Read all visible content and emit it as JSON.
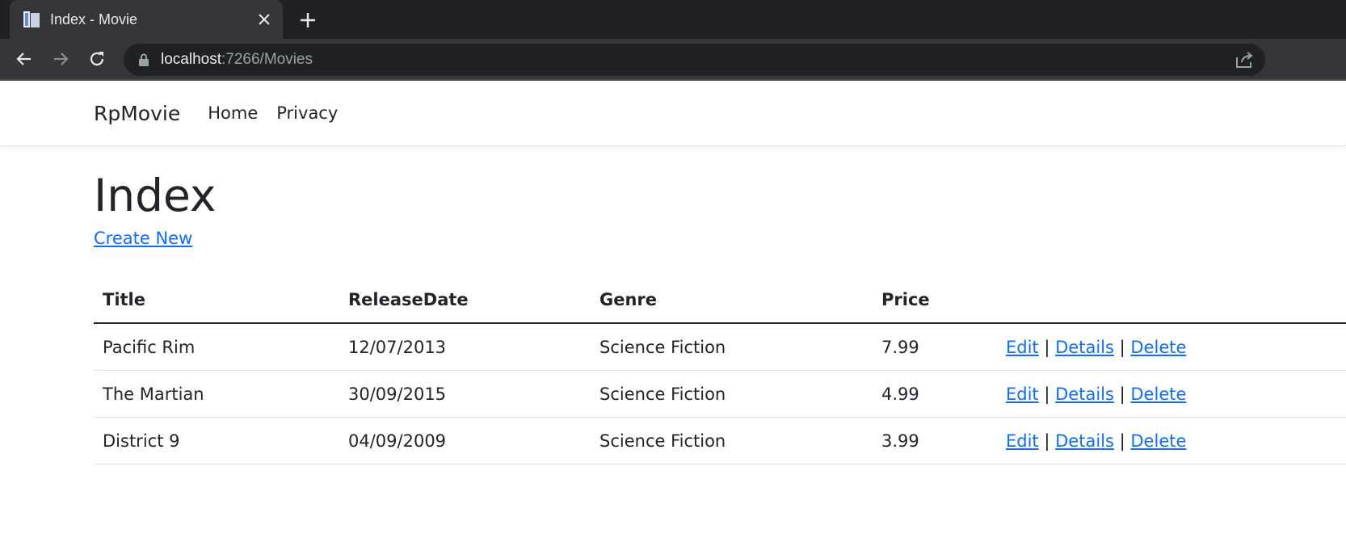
{
  "browser": {
    "tab_title": "Index - Movie",
    "url_host": "localhost",
    "url_rest": ":7266/Movies"
  },
  "site": {
    "brand": "RpMovie",
    "nav": [
      "Home",
      "Privacy"
    ]
  },
  "page": {
    "heading": "Index",
    "create_link": "Create New"
  },
  "table": {
    "columns": [
      "Title",
      "ReleaseDate",
      "Genre",
      "Price",
      ""
    ],
    "rows": [
      {
        "title": "Pacific Rim",
        "release_date": "12/07/2013",
        "genre": "Science Fiction",
        "price": "7.99"
      },
      {
        "title": "The Martian",
        "release_date": "30/09/2015",
        "genre": "Science Fiction",
        "price": "4.99"
      },
      {
        "title": "District 9",
        "release_date": "04/09/2009",
        "genre": "Science Fiction",
        "price": "3.99"
      }
    ],
    "actions": {
      "edit": "Edit",
      "details": "Details",
      "delete": "Delete",
      "separator": "|"
    }
  },
  "colors": {
    "chrome_dark": "#202124",
    "chrome_tab": "#35363a",
    "link": "#0d6efd",
    "text": "#212529"
  },
  "icons": [
    "favicon-icon",
    "close-icon",
    "plus-icon",
    "back-arrow-icon",
    "forward-arrow-icon",
    "reload-icon",
    "lock-icon",
    "share-icon"
  ]
}
